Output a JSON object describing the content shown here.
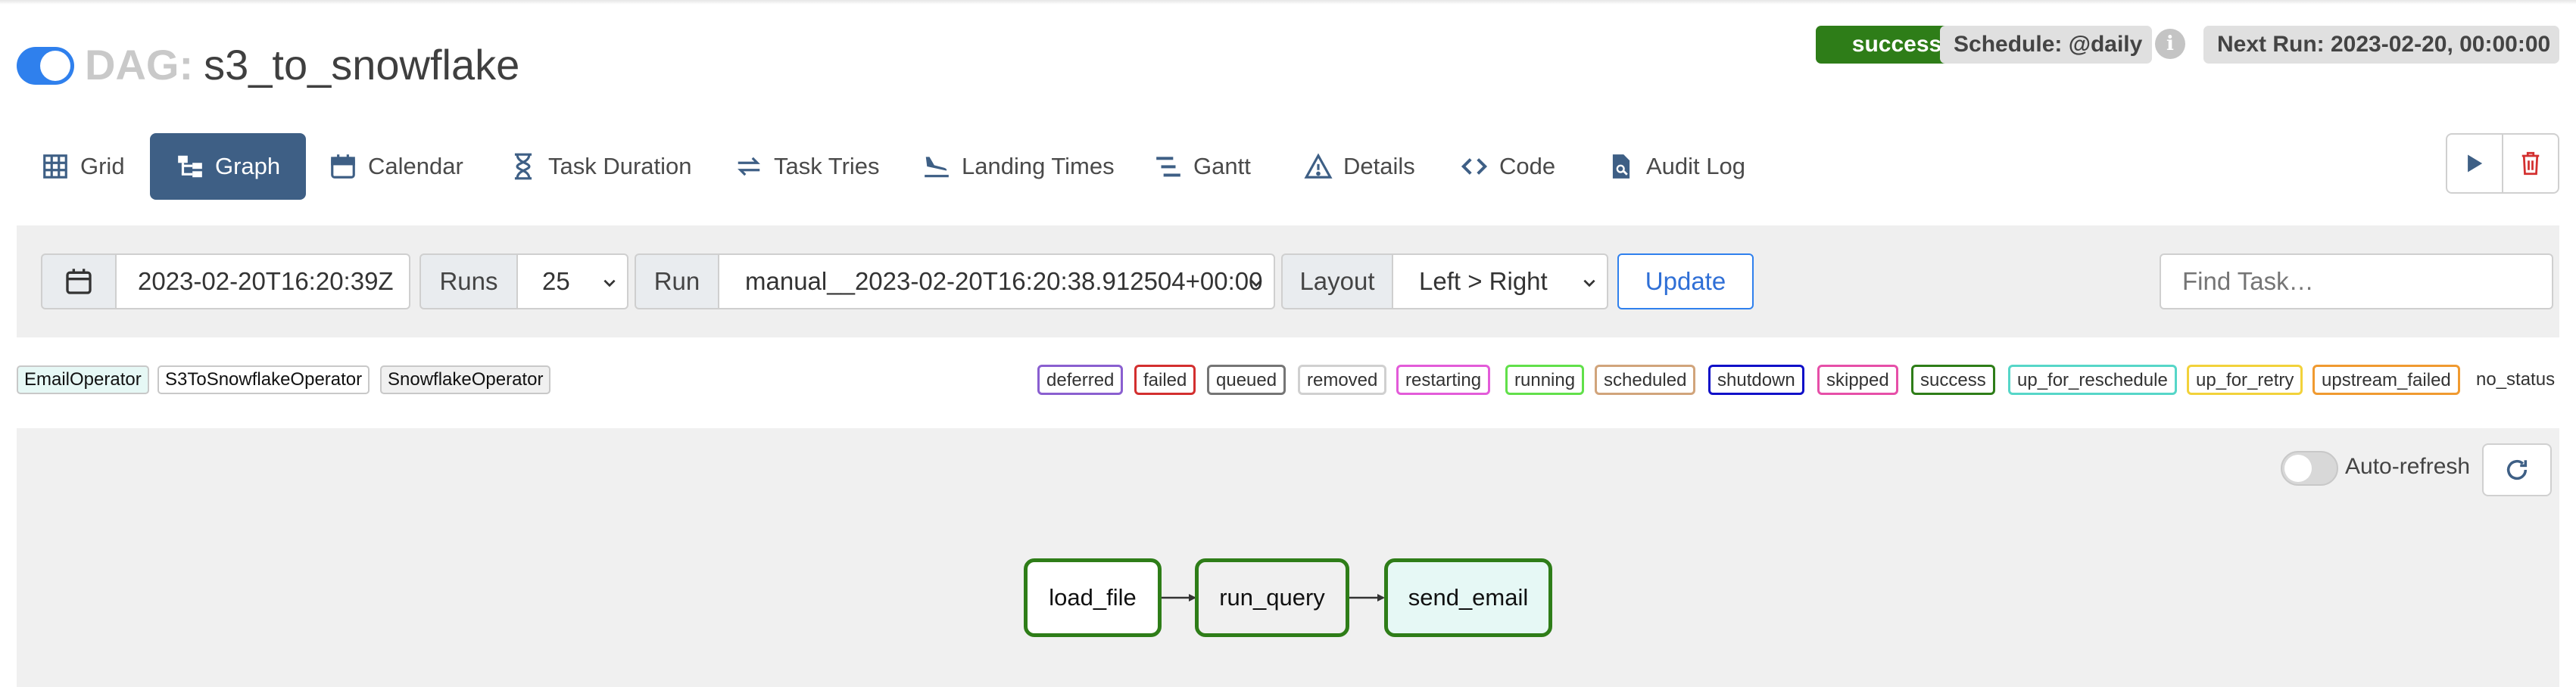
{
  "header": {
    "dag_prefix": "DAG:",
    "dag_name": "s3_to_snowflake",
    "status_badge": "success",
    "schedule": "Schedule: @daily",
    "info_glyph": "i",
    "next_run": "Next Run: 2023-02-20, 00:00:00"
  },
  "nav": {
    "tabs": [
      {
        "label": "Grid",
        "icon": "grid-icon"
      },
      {
        "label": "Graph",
        "icon": "graph-icon",
        "active": true
      },
      {
        "label": "Calendar",
        "icon": "calendar-icon"
      },
      {
        "label": "Task Duration",
        "icon": "hourglass-icon"
      },
      {
        "label": "Task Tries",
        "icon": "retry-arrows-icon"
      },
      {
        "label": "Landing Times",
        "icon": "plane-landing-icon"
      },
      {
        "label": "Gantt",
        "icon": "gantt-icon"
      },
      {
        "label": "Details",
        "icon": "warning-triangle-icon"
      },
      {
        "label": "Code",
        "icon": "code-icon"
      },
      {
        "label": "Audit Log",
        "icon": "file-search-icon"
      }
    ],
    "actions": {
      "trigger": "play-icon",
      "delete": "trash-icon"
    }
  },
  "toolbar": {
    "base_date": "2023-02-20T16:20:39Z",
    "runs_label": "Runs",
    "runs_value": "25",
    "run_label": "Run",
    "run_value": "manual__2023-02-20T16:20:38.912504+00:00",
    "layout_label": "Layout",
    "layout_value": "Left > Right",
    "update_label": "Update",
    "find_placeholder": "Find Task…"
  },
  "legend": {
    "operators": [
      "EmailOperator",
      "S3ToSnowflakeOperator",
      "SnowflakeOperator"
    ],
    "states": [
      {
        "label": "deferred",
        "color": "#8a5fd0"
      },
      {
        "label": "failed",
        "color": "#d32f2f"
      },
      {
        "label": "queued",
        "color": "#757575"
      },
      {
        "label": "removed",
        "color": "#d0d0d0"
      },
      {
        "label": "restarting",
        "color": "#e35bd9"
      },
      {
        "label": "running",
        "color": "#61e04a"
      },
      {
        "label": "scheduled",
        "color": "#d1a47b"
      },
      {
        "label": "shutdown",
        "color": "#1010c8"
      },
      {
        "label": "skipped",
        "color": "#e64fa8"
      },
      {
        "label": "success",
        "color": "#2e7d18"
      },
      {
        "label": "up_for_reschedule",
        "color": "#56d6c8"
      },
      {
        "label": "up_for_retry",
        "color": "#f2d23a"
      },
      {
        "label": "upstream_failed",
        "color": "#f09a30"
      }
    ],
    "no_status": "no_status"
  },
  "graph": {
    "auto_refresh_label": "Auto-refresh",
    "nodes": [
      {
        "label": "load_file",
        "fill": "#ffffff"
      },
      {
        "label": "run_query",
        "fill": "#f0f0f0"
      },
      {
        "label": "send_email",
        "fill": "#e6f8f5"
      }
    ],
    "success_color": "#2e7d18"
  }
}
